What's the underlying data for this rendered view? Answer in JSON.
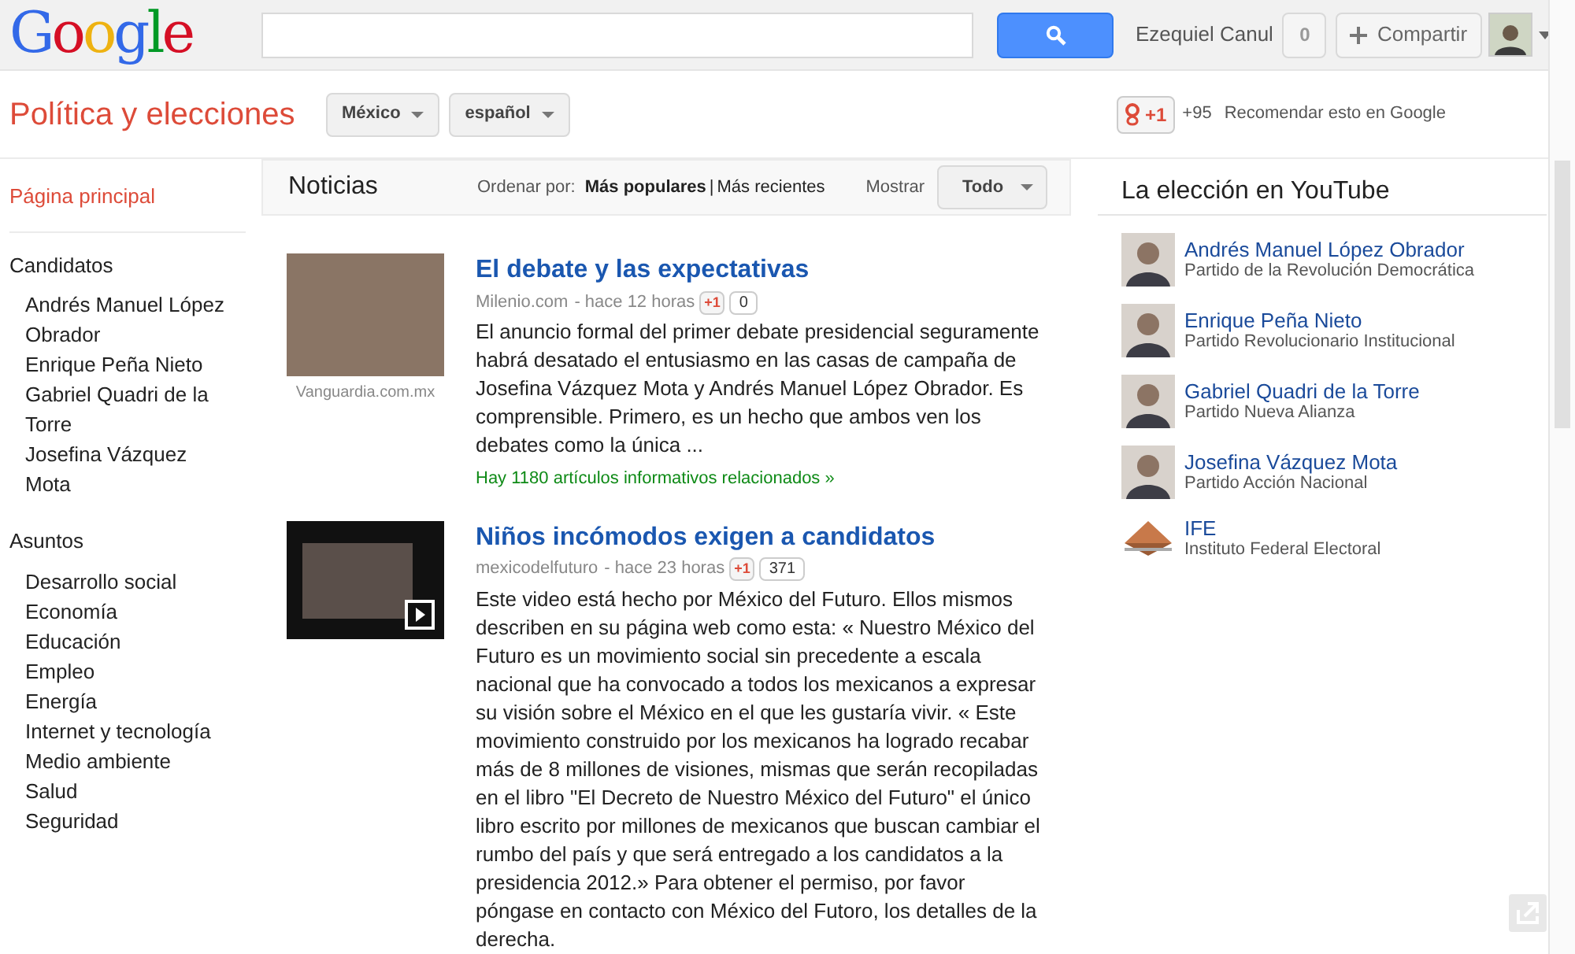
{
  "header": {
    "logo": "Google",
    "user_name": "Ezequiel Canul",
    "notifications": "0",
    "share_button": "Compartir"
  },
  "topbar": {
    "title": "Política y elecciones",
    "filters": [
      {
        "label": "México"
      },
      {
        "label": "español"
      }
    ],
    "plusone": "+1",
    "plusone_count": "+95",
    "recommend": "Recomendar esto en Google"
  },
  "sidebar": {
    "home": {
      "label": "Página principal",
      "selected": true
    },
    "sections": [
      {
        "title": "Candidatos",
        "items": [
          "Andrés Manuel López Obrador",
          "Enrique Peña Nieto",
          "Gabriel Quadri de la Torre",
          "Josefina Vázquez Mota"
        ]
      },
      {
        "title": "Asuntos",
        "items": [
          "Desarrollo social",
          "Economía",
          "Educación",
          "Empleo",
          "Energía",
          "Internet y tecnología",
          "Medio ambiente",
          "Salud",
          "Seguridad"
        ]
      }
    ]
  },
  "news": {
    "title": "Noticias",
    "sort_label": "Ordenar por:",
    "sort_separator": "|",
    "sort_options": [
      {
        "label": "Más populares",
        "selected": true
      },
      {
        "label": "Más recientes",
        "selected": false
      }
    ],
    "show_label": "Mostrar",
    "show_value": "Todo",
    "articles": [
      {
        "kind": "photo",
        "thumb_caption": "Vanguardia.com.mx",
        "title": "El debate y las expectativas",
        "source": "Milenio.com",
        "time": "- hace 12 horas",
        "plusone": "+1",
        "count": "0",
        "body": "El anuncio formal del primer debate presidencial seguramente habrá desatado el entusiasmo en las casas de campaña de Josefina Vázquez Mota y Andrés Manuel López Obrador. Es comprensible. Primero, es un hecho que ambos ven los debates como la única ...",
        "related": "Hay 1180 artículos informativos relacionados »"
      },
      {
        "kind": "video",
        "title": "Niños incómodos exigen a candidatos",
        "source": "mexicodelfuturo",
        "time": "- hace 23 horas",
        "plusone": "+1",
        "count": "371",
        "body": "Este video está hecho por México del Futuro. Ellos mismos describen en su página web como esta: « Nuestro México del Futuro es un movimiento social sin precedente a escala nacional que ha convocado a todos los mexicanos a expresar su visión sobre el México en el que les gustaría vivir. « Este movimiento construido por los mexicanos ha logrado recabar más de 8 millones de visiones, mismas que serán recopiladas en el libro \"El Decreto de Nuestro México del Futuro\" el único libro escrito por millones de mexicanos que buscan cambiar el rumbo del país y que será entregado a los candidatos a la presidencia 2012.» Para obtener el permiso, por favor póngase en contacto con México del Futoro, los detalles de la derecha."
      }
    ]
  },
  "youtube": {
    "title": "La elección en YouTube",
    "channels": [
      {
        "kind": "person",
        "name": "Andrés Manuel López Obrador",
        "party": "Partido de la Revolución Democrática"
      },
      {
        "kind": "person",
        "name": "Enrique Peña Nieto",
        "party": "Partido Revolucionario Institucional"
      },
      {
        "kind": "person",
        "name": "Gabriel Quadri de la Torre",
        "party": "Partido Nueva Alianza"
      },
      {
        "kind": "person",
        "name": "Josefina Vázquez Mota",
        "party": "Partido Acción Nacional"
      },
      {
        "kind": "logo",
        "name": "IFE",
        "party": "Instituto Federal Electoral"
      }
    ]
  }
}
